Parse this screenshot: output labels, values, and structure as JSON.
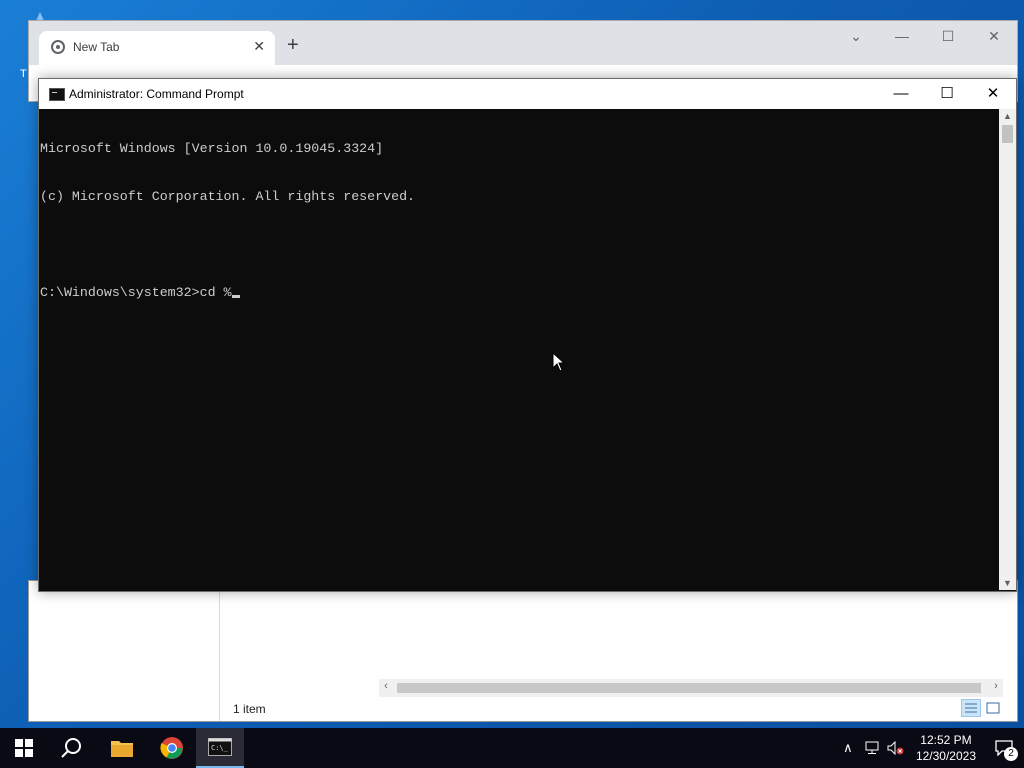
{
  "desktop": {
    "icon_label": "T"
  },
  "explorer": {
    "status_text": "1 item"
  },
  "chrome": {
    "tab_title": "New Tab",
    "tab_close": "✕",
    "new_tab": "+",
    "ctrl_dropdown": "⌄",
    "ctrl_minimize": "—",
    "ctrl_maximize": "☐",
    "ctrl_close": "✕"
  },
  "cmd": {
    "title": "Administrator: Command Prompt",
    "ctrl_minimize": "—",
    "ctrl_maximize": "☐",
    "ctrl_close": "✕",
    "lines": [
      "Microsoft Windows [Version 10.0.19045.3324]",
      "(c) Microsoft Corporation. All rights reserved.",
      "",
      "C:\\Windows\\system32>cd %"
    ]
  },
  "taskbar": {
    "clock_time": "12:52 PM",
    "clock_date": "12/30/2023",
    "notification_count": "2",
    "tray_chevron": "∧"
  },
  "colors": {
    "console_bg": "#0c0c0c",
    "console_fg": "#cccccc",
    "taskbar_bg": "#0a0a14",
    "accent": "#76b9ed"
  }
}
